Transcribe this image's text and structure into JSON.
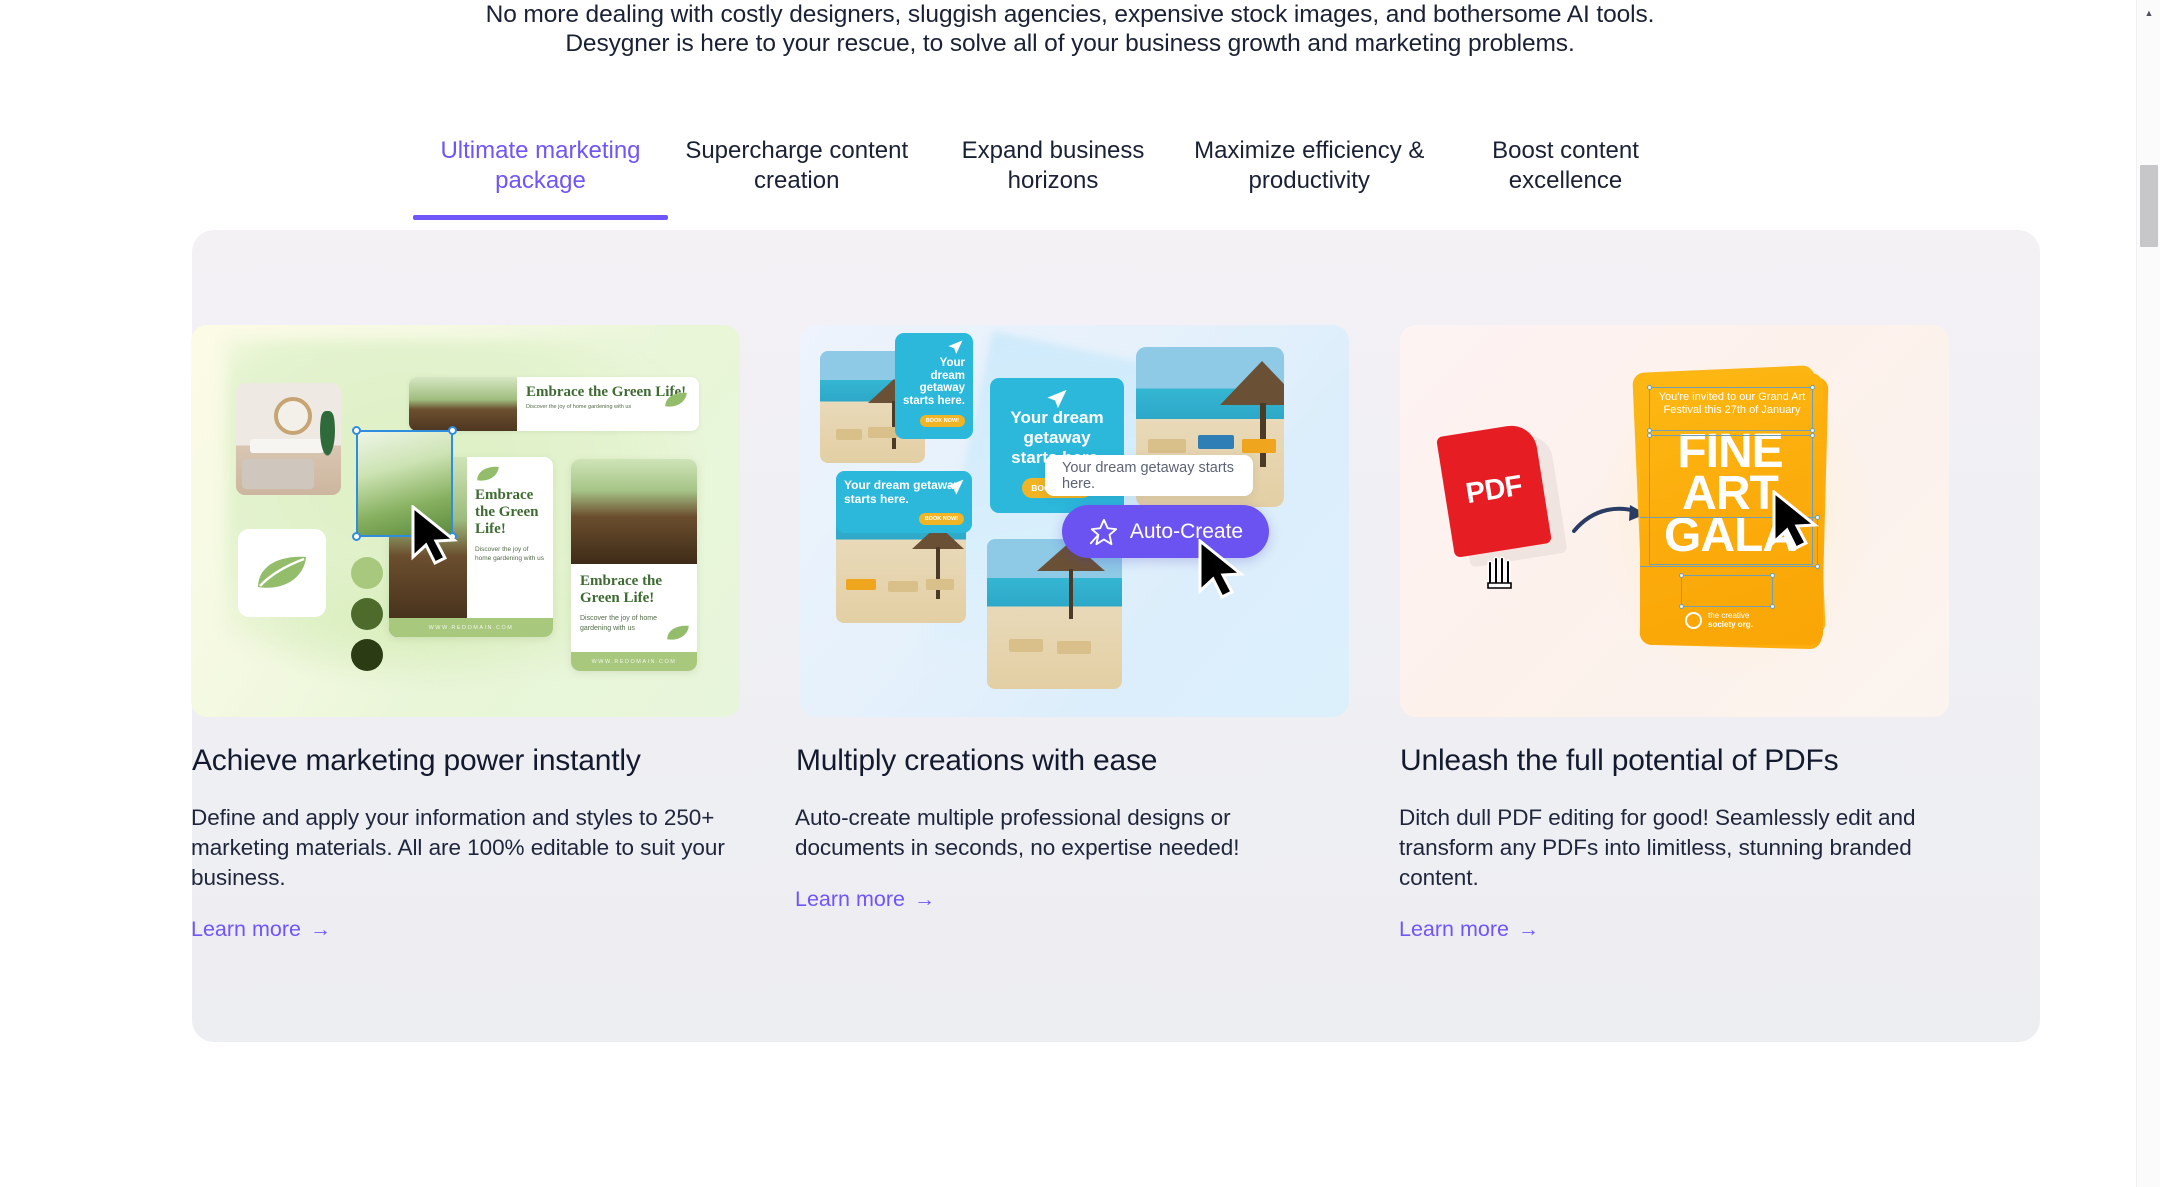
{
  "intro": {
    "line1": "No more dealing with costly designers, sluggish agencies, expensive stock images, and bothersome AI tools.",
    "line2": "Desygner is here to your rescue, to solve all of your business growth and marketing problems."
  },
  "tabs": [
    {
      "label": "Ultimate marketing package",
      "active": true
    },
    {
      "label": "Supercharge content creation",
      "active": false
    },
    {
      "label": "Expand business horizons",
      "active": false
    },
    {
      "label": "Maximize efficiency & productivity",
      "active": false
    },
    {
      "label": "Boost content excellence",
      "active": false
    }
  ],
  "cards": [
    {
      "title": "Achieve marketing power instantly",
      "body": "Define and apply your information and styles to 250+ marketing materials. All are 100% editable to suit your business.",
      "link_label": "Learn more",
      "link_arrow": "→",
      "artwork": {
        "template_heading": "Embrace the Green Life!",
        "template_sub": "Discover the joy of home gardening with us",
        "template_footer": "WWW.REDOMAIN.COM",
        "icon": "leaf-icon",
        "cursor": "arrow-cursor"
      }
    },
    {
      "title": "Multiply creations with ease",
      "body": "Auto-create multiple professional designs or documents in seconds, no expertise needed!",
      "link_label": "Learn more",
      "link_arrow": "→",
      "artwork": {
        "template_heading": "Your dream getaway starts here.",
        "template_cta": "BOOK NOW!",
        "template_cta_small": "BOOK NOW!",
        "prompt_value": "Your dream getaway starts here.",
        "auto_create_label": "Auto-Create",
        "icon": "magic-wand-star-icon",
        "cursor": "arrow-cursor"
      }
    },
    {
      "title": "Unleash the full potential of PDFs",
      "body": "Ditch dull PDF editing for good! Seamlessly edit and transform any PDFs into limitless, stunning branded content.",
      "link_label": "Learn more",
      "link_arrow": "→",
      "artwork": {
        "pdf_label": "PDF",
        "poster_invite": "You're invited to our Grand Art Festival this 27th of January",
        "poster_title_line1": "FINE",
        "poster_title_line2": "ART",
        "poster_title_line3": "GALA",
        "poster_logo_line1": "the creative",
        "poster_logo_line2": "society org.",
        "cursor": "arrow-cursor",
        "grab_cursor": "grab-hand-cursor"
      }
    }
  ],
  "scrollbar": {
    "up_arrow": "▲"
  },
  "colors": {
    "accent": "#6e56f8",
    "text": "#141a2e",
    "panel_bg": "#f0f0f4",
    "cta_yellow": "#f0b424",
    "cyan": "#2cb8db",
    "pdf_red": "#e71d24",
    "poster_orange": "#fdb813"
  }
}
